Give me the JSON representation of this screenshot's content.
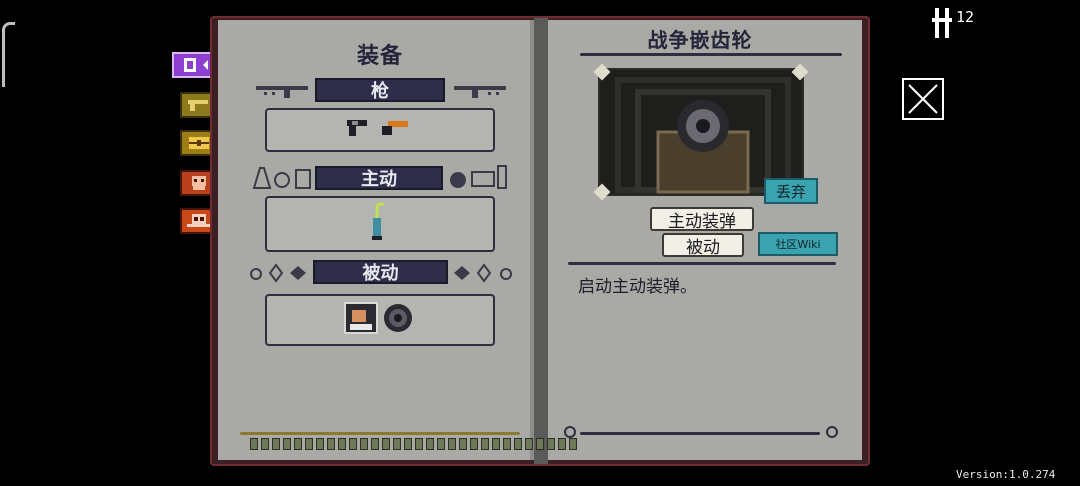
{
  "left_page": {
    "title": "装备",
    "sections": {
      "guns": "枪",
      "active": "主动",
      "passive": "被动"
    }
  },
  "right_page": {
    "item_name": "战争嵌齿轮",
    "drop_button": "丢弃",
    "tag_active_reload": "主动装弹",
    "tag_passive": "被动",
    "wiki_button": "社区Wiki",
    "description": "启动主动装弹。"
  },
  "hud": {
    "ammo_count": "12",
    "version": "Version:1.0.274"
  },
  "tabs": [
    {
      "name": "equipment",
      "icon": "equipment-icon",
      "color": "#8c3fd0"
    },
    {
      "name": "guns",
      "icon": "gun-icon",
      "color": "#8c7a1c"
    },
    {
      "name": "items",
      "icon": "chest-icon",
      "color": "#9c7d16"
    },
    {
      "name": "enemies",
      "icon": "npc-icon",
      "color": "#b8401c"
    },
    {
      "name": "bosses",
      "icon": "skull-icon",
      "color": "#c8481a"
    }
  ],
  "colors": {
    "book_border": "#6e2d35",
    "page": "#a9a9a6",
    "section_bar": "#2e2e4a",
    "teal_button": "#3aa3b0"
  }
}
